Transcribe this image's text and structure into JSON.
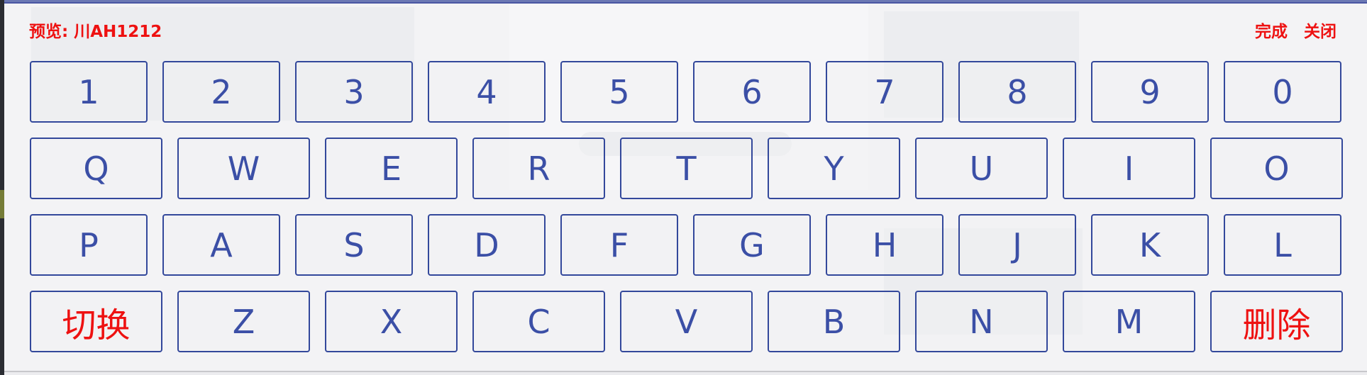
{
  "header": {
    "preview_label": "预览: 川AH1212",
    "done_label": "完成",
    "close_label": "关闭"
  },
  "colors": {
    "accent": "#33489b",
    "key_text": "#3b4fa6",
    "alert_text": "#ee1111"
  },
  "keyboard": {
    "row1": [
      "1",
      "2",
      "3",
      "4",
      "5",
      "6",
      "7",
      "8",
      "9",
      "0"
    ],
    "row2": [
      "Q",
      "W",
      "E",
      "R",
      "T",
      "Y",
      "U",
      "I",
      "O"
    ],
    "row3": [
      "P",
      "A",
      "S",
      "D",
      "F",
      "G",
      "H",
      "J",
      "K",
      "L"
    ],
    "row4": [
      "切换",
      "Z",
      "X",
      "C",
      "V",
      "B",
      "N",
      "M",
      "删除"
    ]
  }
}
